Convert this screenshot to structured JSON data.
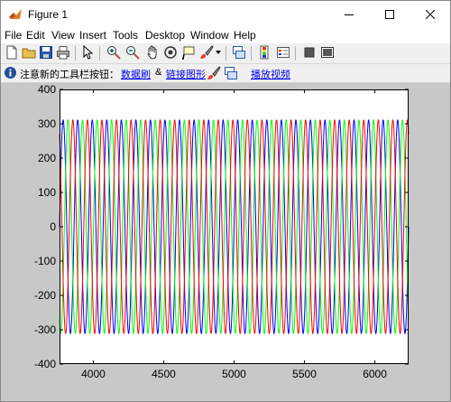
{
  "window": {
    "title": "Figure 1"
  },
  "menu": [
    "File",
    "Edit",
    "View",
    "Insert",
    "Tools",
    "Desktop",
    "Window",
    "Help"
  ],
  "toolbar_icons": [
    "new-figure-icon",
    "open-file-icon",
    "save-icon",
    "print-icon",
    "select-arrow-icon",
    "zoom-in-icon",
    "zoom-out-icon",
    "pan-hand-icon",
    "rotate-3d-icon",
    "data-cursor-icon",
    "brush-icon",
    "link-plot-icon",
    "colorbar-icon",
    "legend-icon",
    "hide-plot-tools-icon",
    "show-plot-tools-icon"
  ],
  "infobar": {
    "text": "注意新的工具栏按钮：",
    "link1": "数据刷",
    "amp": "&",
    "link2": "链接图形",
    "link3": "播放视频"
  },
  "chart_data": {
    "type": "line",
    "xlim": [
      3760,
      4240
    ],
    "ylim": [
      -400,
      400
    ],
    "xticks": [
      4000,
      4500,
      5000,
      5500,
      6000
    ],
    "yticks": [
      400,
      300,
      200,
      100,
      0,
      -100,
      -200,
      -300,
      -400
    ],
    "series": [
      {
        "color": "#0000ff",
        "amplitude": 311,
        "phase_deg": 0
      },
      {
        "color": "#00ff00",
        "amplitude": 311,
        "phase_deg": -120
      },
      {
        "color": "#ff0000",
        "amplitude": 311,
        "phase_deg": 120
      }
    ],
    "cycles_visible": 24,
    "xaxis_labels": [
      "4000",
      "4500",
      "5000",
      "5500",
      "6000"
    ],
    "yaxis_labels": [
      "400",
      "300",
      "200",
      "100",
      "0",
      "-100",
      "-200",
      "-300",
      "-400"
    ]
  },
  "colors": {
    "figure_bg": "#c8c8c8",
    "link": "#0000ee"
  }
}
